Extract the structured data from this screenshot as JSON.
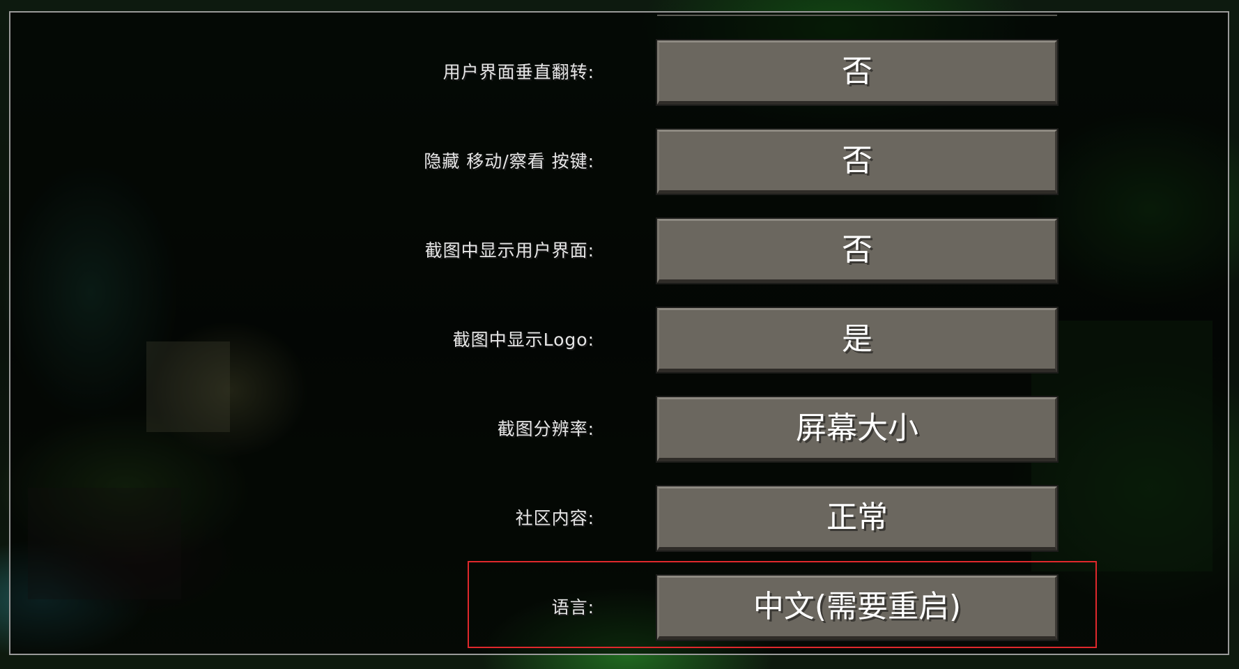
{
  "settings": [
    {
      "label": "用户界面垂直翻转:",
      "value": "否"
    },
    {
      "label": "隐藏 移动/察看 按键:",
      "value": "否"
    },
    {
      "label": "截图中显示用户界面:",
      "value": "否"
    },
    {
      "label": "截图中显示Logo:",
      "value": "是"
    },
    {
      "label": "截图分辨率:",
      "value": "屏幕大小"
    },
    {
      "label": "社区内容:",
      "value": "正常"
    },
    {
      "label": "语言:",
      "value": "中文(需要重启)"
    }
  ],
  "colors": {
    "button_face": "#6b675f",
    "highlight_border": "#e0282c",
    "label_text": "#e6e6e6"
  }
}
